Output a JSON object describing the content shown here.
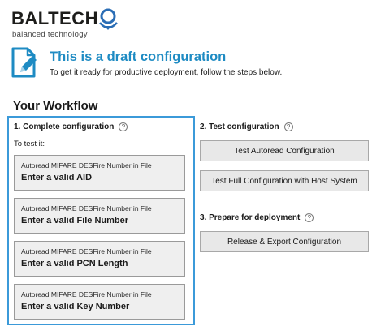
{
  "logo": {
    "brand": "BALTECH",
    "tagline": "balanced technology"
  },
  "draft": {
    "title": "This is a draft configuration",
    "subtitle": "To get it ready for productive deployment, follow the steps below."
  },
  "workflow": {
    "heading": "Your Workflow",
    "step1": {
      "title": "1. Complete configuration",
      "test_label": "To test it:",
      "cards": [
        {
          "caption": "Autoread MIFARE DESFire Number in File",
          "action": "Enter a valid AID"
        },
        {
          "caption": "Autoread MIFARE DESFire Number in File",
          "action": "Enter a valid File Number"
        },
        {
          "caption": "Autoread MIFARE DESFire Number in File",
          "action": "Enter a valid PCN Length"
        },
        {
          "caption": "Autoread MIFARE DESFire Number in File",
          "action": "Enter a valid Key Number"
        }
      ]
    },
    "step2": {
      "title": "2. Test configuration",
      "buttons": [
        "Test Autoread Configuration",
        "Test Full Configuration with Host System"
      ]
    },
    "step3": {
      "title": "3. Prepare for deployment",
      "buttons": [
        "Release & Export Configuration"
      ]
    }
  },
  "icons": {
    "help": "question-circle-icon",
    "draft": "document-edit-icon",
    "logo": "baltech-logo-icon"
  },
  "colors": {
    "accent": "#1e8bc3",
    "panel_border": "#3b9ad9",
    "logo_blue": "#2a6db5"
  }
}
